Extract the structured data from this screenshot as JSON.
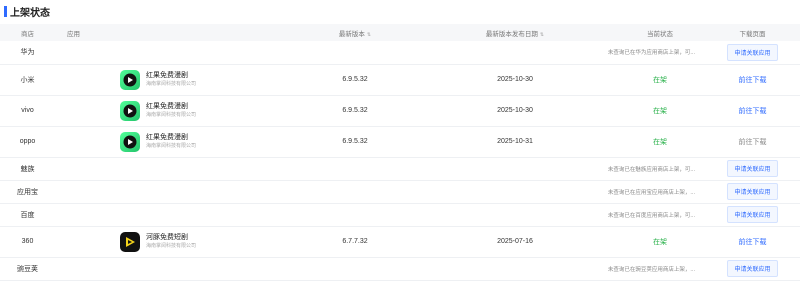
{
  "section_title": "上架状态",
  "columns": {
    "store": "商店",
    "app": "应用",
    "version": "最新版本",
    "date": "最新版本发布日期",
    "status": "当前状态",
    "page": "下载页面"
  },
  "rows": [
    {
      "store": "华为",
      "app_name": "",
      "app_company": "",
      "version": "",
      "date": "",
      "status_text": "",
      "note": "未查询已在华为应用商店上架，可...",
      "action": "申请关联应用",
      "action_type": "button",
      "icon": ""
    },
    {
      "store": "小米",
      "app_name": "红果免费漫剧",
      "app_company": "海南掌阅科技有限公司",
      "version": "6.9.5.32",
      "date": "2025-10-30",
      "status_text": "在架",
      "note": "",
      "action": "前往下载",
      "action_type": "link",
      "icon": "hongguo-app-icon"
    },
    {
      "store": "vivo",
      "app_name": "红果免费漫剧",
      "app_company": "海南掌阅科技有限公司",
      "version": "6.9.5.32",
      "date": "2025-10-30",
      "status_text": "在架",
      "note": "",
      "action": "前往下载",
      "action_type": "link",
      "icon": "hongguo-app-icon"
    },
    {
      "store": "oppo",
      "app_name": "红果免费漫剧",
      "app_company": "海南掌阅科技有限公司",
      "version": "6.9.5.32",
      "date": "2025-10-31",
      "status_text": "在架",
      "note": "",
      "action": "前往下载",
      "action_type": "disabled",
      "icon": "hongguo-app-icon"
    },
    {
      "store": "魅族",
      "app_name": "",
      "app_company": "",
      "version": "",
      "date": "",
      "status_text": "",
      "note": "未查询已在魅族应用商店上架，可...",
      "action": "申请关联应用",
      "action_type": "button",
      "icon": ""
    },
    {
      "store": "应用宝",
      "app_name": "",
      "app_company": "",
      "version": "",
      "date": "",
      "status_text": "",
      "note": "未查询已在应用宝应用商店上架，...",
      "action": "申请关联应用",
      "action_type": "button",
      "icon": ""
    },
    {
      "store": "百度",
      "app_name": "",
      "app_company": "",
      "version": "",
      "date": "",
      "status_text": "",
      "note": "未查询已在百度应用商店上架，可...",
      "action": "申请关联应用",
      "action_type": "button",
      "icon": ""
    },
    {
      "store": "360",
      "app_name": "河豚免费短剧",
      "app_company": "海南掌阅科技有限公司",
      "version": "6.7.7.32",
      "date": "2025-07-16",
      "status_text": "在架",
      "note": "",
      "action": "前往下载",
      "action_type": "link",
      "icon": "hetun-app-icon"
    },
    {
      "store": "豌豆荚",
      "app_name": "",
      "app_company": "",
      "version": "",
      "date": "",
      "status_text": "",
      "note": "未查询已在豌豆荚应用商店上架，...",
      "action": "申请关联应用",
      "action_type": "button",
      "icon": ""
    }
  ],
  "colors": {
    "accent": "#2f6bff",
    "on_shelf": "#2bb24c",
    "icon_green": "#3ddc84"
  }
}
